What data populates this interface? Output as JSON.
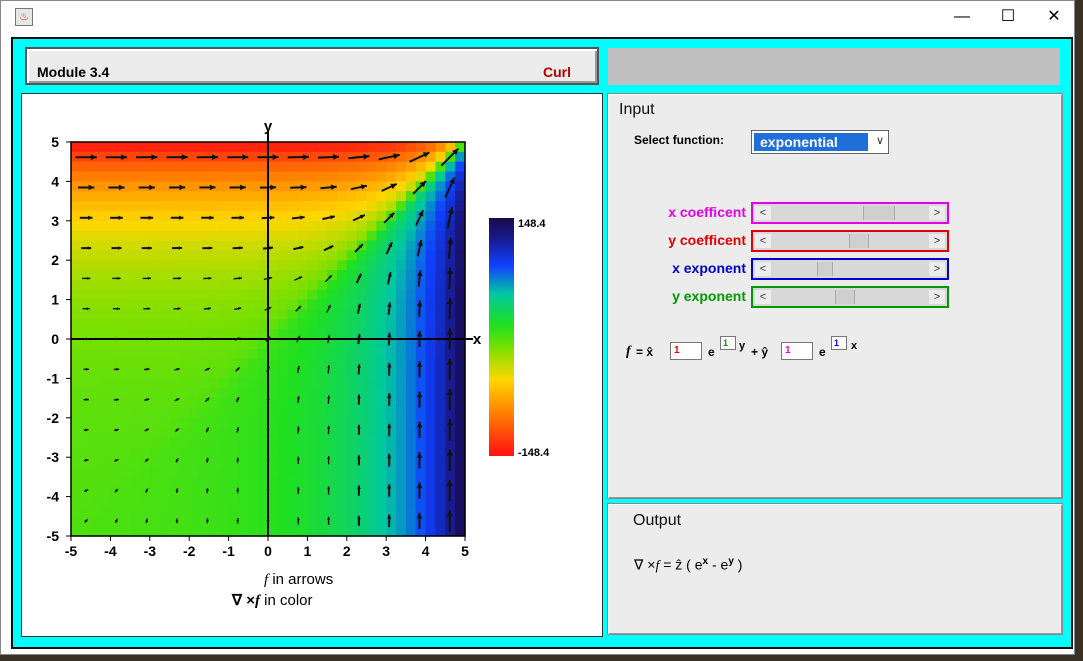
{
  "window": {
    "title": "",
    "minimize_glyph": "—",
    "maximize_glyph": "☐",
    "close_glyph": "✕"
  },
  "header": {
    "module": "Module 3.4",
    "name": "Curl"
  },
  "plot": {
    "x_ticks": [
      "-5",
      "-4",
      "-3",
      "-2",
      "-1",
      "0",
      "1",
      "2",
      "3",
      "4",
      "5"
    ],
    "y_ticks": [
      "5",
      "4",
      "3",
      "2",
      "1",
      "0",
      "-1",
      "-2",
      "-3",
      "-4",
      "-5"
    ],
    "x_axis_label": "x",
    "y_axis_label": "y",
    "caption_line1_sym": "f",
    "caption_line1_text": " in arrows",
    "caption_line2_prefix": "∇ ×",
    "caption_line2_sym": "f",
    "caption_line2_text": " in color",
    "colorbar_max": "148.4",
    "colorbar_min": "-148.4",
    "field_range": [
      -5,
      5
    ]
  },
  "input": {
    "title": "Input",
    "select_label": "Select function:",
    "select_value": "exponential",
    "sliders": [
      {
        "label": "x coefficent",
        "color": "#e600e6"
      },
      {
        "label": "y coefficent",
        "color": "#e00000"
      },
      {
        "label": "x exponent",
        "color": "#0000cc"
      },
      {
        "label": "y exponent",
        "color": "#009900"
      }
    ],
    "formula": {
      "f": "f",
      "eq_xhat": "= x̂",
      "x_coef": "1",
      "e1": "e",
      "y_exp": "1",
      "y_var": "y",
      "plus_yhat": "+ ŷ",
      "y_coef": "1",
      "e2": "e",
      "x_exp": "1",
      "x_var": "x"
    }
  },
  "output": {
    "title": "Output",
    "prefix": "∇ ×",
    "f": "f",
    "eq": " = ẑ ( e",
    "sup1": "x",
    "mid": " - e",
    "sup2": "y",
    "end": " )"
  },
  "colors": {
    "frame": "#00ffff",
    "accent_red": "#b30000",
    "selection_blue": "#1e6fd9"
  }
}
